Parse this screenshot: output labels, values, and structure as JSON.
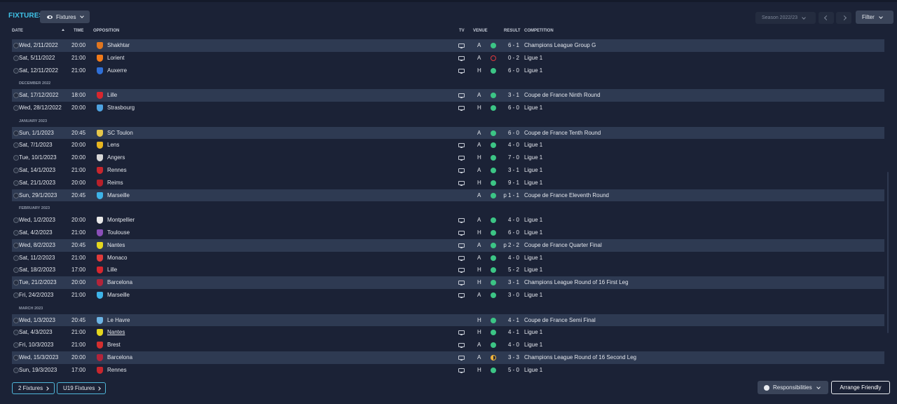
{
  "header": {
    "title": "FIXTURES",
    "view_dropdown": "Fixtures",
    "season": "Season 2022/23",
    "filter": "Filter"
  },
  "columns": {
    "date": "DATE",
    "time": "TIME",
    "opposition": "OPPOSITION",
    "tv": "TV",
    "venue": "VENUE",
    "result": "RESULT",
    "competition": "COMPETITION"
  },
  "colors": {
    "win": "#3cc585",
    "loss": "#e0393e",
    "draw": "#f0b33b",
    "accent": "#3fc3e8"
  },
  "rows": [
    {
      "kind": "match",
      "hl": true,
      "date": "Wed, 2/11/2022",
      "time": "20:00",
      "opp": "Shakhtar",
      "badge": "#e0761f",
      "tv": true,
      "venue": "A",
      "res": "W",
      "score": "6 - 1",
      "comp": "Champions League Group G"
    },
    {
      "kind": "match",
      "hl": false,
      "date": "Sat, 5/11/2022",
      "time": "21:00",
      "opp": "Lorient",
      "badge": "#f07a1a",
      "tv": true,
      "venue": "A",
      "res": "L",
      "score": "0 - 2",
      "comp": "Ligue 1"
    },
    {
      "kind": "match",
      "hl": false,
      "date": "Sat, 12/11/2022",
      "time": "21:00",
      "opp": "Auxerre",
      "badge": "#2f6fd6",
      "tv": true,
      "venue": "H",
      "res": "W",
      "score": "6 - 0",
      "comp": "Ligue 1"
    },
    {
      "kind": "month",
      "label": "DECEMBER 2022"
    },
    {
      "kind": "match",
      "hl": true,
      "date": "Sat, 17/12/2022",
      "time": "18:00",
      "opp": "Lille",
      "badge": "#d7262e",
      "tv": true,
      "venue": "A",
      "res": "W",
      "score": "3 - 1",
      "comp": "Coupe de France Ninth Round"
    },
    {
      "kind": "match",
      "hl": false,
      "date": "Wed, 28/12/2022",
      "time": "20:00",
      "opp": "Strasbourg",
      "badge": "#4ea2e0",
      "tv": true,
      "venue": "H",
      "res": "W",
      "score": "6 - 0",
      "comp": "Ligue 1"
    },
    {
      "kind": "month",
      "label": "JANUARY 2023"
    },
    {
      "kind": "match",
      "hl": true,
      "date": "Sun, 1/1/2023",
      "time": "20:45",
      "opp": "SC Toulon",
      "badge": "#e6c74a",
      "tv": false,
      "venue": "A",
      "res": "W",
      "score": "6 - 0",
      "comp": "Coupe de France Tenth Round"
    },
    {
      "kind": "match",
      "hl": false,
      "date": "Sat, 7/1/2023",
      "time": "20:00",
      "opp": "Lens",
      "badge": "#e7b520",
      "tv": true,
      "venue": "A",
      "res": "W",
      "score": "4 - 0",
      "comp": "Ligue 1"
    },
    {
      "kind": "match",
      "hl": false,
      "date": "Tue, 10/1/2023",
      "time": "20:00",
      "opp": "Angers",
      "badge": "#d8d8d8",
      "tv": true,
      "venue": "H",
      "res": "W",
      "score": "7 - 0",
      "comp": "Ligue 1"
    },
    {
      "kind": "match",
      "hl": false,
      "date": "Sat, 14/1/2023",
      "time": "21:00",
      "opp": "Rennes",
      "badge": "#c8262d",
      "tv": true,
      "venue": "A",
      "res": "W",
      "score": "3 - 1",
      "comp": "Ligue 1"
    },
    {
      "kind": "match",
      "hl": false,
      "date": "Sat, 21/1/2023",
      "time": "20:00",
      "opp": "Reims",
      "badge": "#b7202a",
      "tv": true,
      "venue": "H",
      "res": "W",
      "score": "9 - 1",
      "comp": "Ligue 1"
    },
    {
      "kind": "match",
      "hl": true,
      "date": "Sun, 29/1/2023",
      "time": "20:45",
      "opp": "Marseille",
      "badge": "#3db3e8",
      "tv": false,
      "venue": "A",
      "res": "W",
      "score": "p 1 - 1",
      "comp": "Coupe de France Eleventh Round"
    },
    {
      "kind": "month",
      "label": "FEBRUARY 2023"
    },
    {
      "kind": "match",
      "hl": false,
      "date": "Wed, 1/2/2023",
      "time": "20:00",
      "opp": "Montpellier",
      "badge": "#e8e8e8",
      "tv": true,
      "venue": "A",
      "res": "W",
      "score": "4 - 0",
      "comp": "Ligue 1"
    },
    {
      "kind": "match",
      "hl": false,
      "date": "Sat, 4/2/2023",
      "time": "21:00",
      "opp": "Toulouse",
      "badge": "#8a4fb8",
      "tv": true,
      "venue": "H",
      "res": "W",
      "score": "6 - 0",
      "comp": "Ligue 1"
    },
    {
      "kind": "match",
      "hl": true,
      "date": "Wed, 8/2/2023",
      "time": "20:45",
      "opp": "Nantes",
      "badge": "#e4d61e",
      "tv": true,
      "venue": "A",
      "res": "W",
      "score": "p 2 - 2",
      "comp": "Coupe de France Quarter Final"
    },
    {
      "kind": "match",
      "hl": false,
      "date": "Sat, 11/2/2023",
      "time": "21:00",
      "opp": "Monaco",
      "badge": "#e03b3b",
      "tv": true,
      "venue": "A",
      "res": "W",
      "score": "4 - 0",
      "comp": "Ligue 1"
    },
    {
      "kind": "match",
      "hl": false,
      "date": "Sat, 18/2/2023",
      "time": "17:00",
      "opp": "Lille",
      "badge": "#d7262e",
      "tv": true,
      "venue": "H",
      "res": "W",
      "score": "5 - 2",
      "comp": "Ligue 1"
    },
    {
      "kind": "match",
      "hl": true,
      "date": "Tue, 21/2/2023",
      "time": "20:00",
      "opp": "Barcelona",
      "badge": "#b3243a",
      "tv": true,
      "venue": "H",
      "res": "W",
      "score": "3 - 1",
      "comp": "Champions League Round of 16  First Leg"
    },
    {
      "kind": "match",
      "hl": false,
      "date": "Fri, 24/2/2023",
      "time": "21:00",
      "opp": "Marseille",
      "badge": "#3db3e8",
      "tv": true,
      "venue": "A",
      "res": "W",
      "score": "3 - 0",
      "comp": "Ligue 1"
    },
    {
      "kind": "month",
      "label": "MARCH 2023"
    },
    {
      "kind": "match",
      "hl": true,
      "date": "Wed, 1/3/2023",
      "time": "20:45",
      "opp": "Le Havre",
      "badge": "#6cb4e4",
      "tv": false,
      "venue": "H",
      "res": "W",
      "score": "4 - 1",
      "comp": "Coupe de France Semi Final"
    },
    {
      "kind": "match",
      "hl": false,
      "date": "Sat, 4/3/2023",
      "time": "21:00",
      "opp": "Nantes",
      "badge": "#e4d61e",
      "tv": true,
      "venue": "H",
      "res": "W",
      "score": "4 - 1",
      "comp": "Ligue 1",
      "underline": true
    },
    {
      "kind": "match",
      "hl": false,
      "date": "Fri, 10/3/2023",
      "time": "21:00",
      "opp": "Brest",
      "badge": "#d32f2f",
      "tv": true,
      "venue": "A",
      "res": "W",
      "score": "4 - 0",
      "comp": "Ligue 1"
    },
    {
      "kind": "match",
      "hl": true,
      "date": "Wed, 15/3/2023",
      "time": "20:00",
      "opp": "Barcelona",
      "badge": "#b3243a",
      "tv": true,
      "venue": "A",
      "res": "D",
      "score": "3 - 3",
      "comp": "Champions League Round of 16  Second Leg"
    },
    {
      "kind": "match",
      "hl": false,
      "date": "Sun, 19/3/2023",
      "time": "17:00",
      "opp": "Rennes",
      "badge": "#c8262d",
      "tv": true,
      "venue": "H",
      "res": "W",
      "score": "5 - 0",
      "comp": "Ligue 1"
    }
  ],
  "footer": {
    "tab1": "2 Fixtures",
    "tab2": "U19 Fixtures",
    "responsibilities": "Responsibilities",
    "arrange": "Arrange Friendly"
  }
}
